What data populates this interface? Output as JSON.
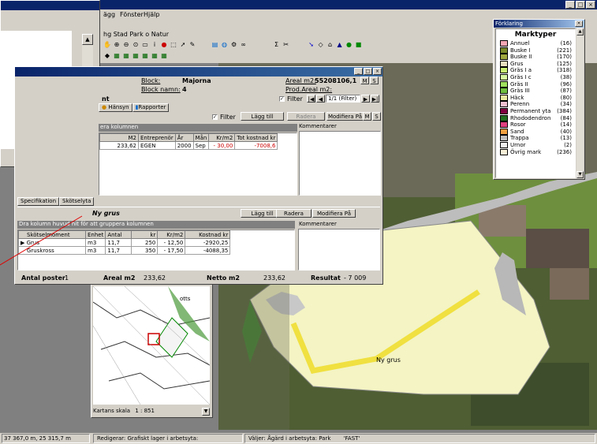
{
  "app": {
    "menu": [
      "ägg",
      "Fönster",
      "Hjälp"
    ],
    "toolbar_text": "hg Stad  Park o Natur",
    "window_controls": [
      "_",
      "□",
      "×"
    ]
  },
  "dialog": {
    "block_label": "Block:",
    "block_value": "Majorna",
    "block_name_label": "Block namn:",
    "block_name_value": "4",
    "areal_label": "Areal m2:",
    "areal_value": "55208106,1",
    "prod_areal_label": "Prod.Areal m2:",
    "filter_label": "Filter",
    "nav_text": "1/1 (Filter)",
    "tabs": [
      "Hänsyn",
      "Rapporter"
    ],
    "m_label": "M",
    "s_label": "S",
    "nt_label": "nt",
    "filter2_label": "Filter",
    "lagg_till": "Lägg till",
    "radera": "Radera",
    "modifiera": "Modifiera På",
    "group_hint": "era kolumnen",
    "kommentarer": "Kommentarer",
    "upper_headers": [
      "M2",
      "Entreprenör",
      "År",
      "Mån",
      "Kr/m2",
      "Tot kostnad kr"
    ],
    "upper_row": [
      "233,62",
      "EGEN",
      "2000",
      "Sep",
      "- 30,00",
      "-7008,6"
    ],
    "lower_tabs": [
      "Specifikation",
      "Skötselyta"
    ],
    "lower_title": "Ny grus",
    "lower_lagg_till": "Lägg till",
    "lower_radera": "Radera",
    "lower_modifiera": "Modifiera På",
    "lower_group_hint": "Dra kolumn huvud hit för att gruppera kolumnen",
    "lower_kommentarer": "Kommentarer",
    "lower_headers": [
      "Skötselmoment",
      "Enhet",
      "Antal",
      "kr",
      "Kr/m2",
      "Kostnad kr"
    ],
    "lower_rows": [
      [
        "Grus",
        "m3",
        "11,7",
        "250",
        "- 12,50",
        "-2920,25"
      ],
      [
        "Gruskross",
        "m3",
        "11,7",
        "350",
        "- 17,50",
        "-4088,35"
      ]
    ],
    "footer": {
      "antal_label": "Antal poster",
      "antal_value": "1",
      "areal_label": "Areal m2",
      "areal_value": "233,62",
      "netto_label": "Netto m2",
      "netto_value": "233,62",
      "resultat_label": "Resultat",
      "resultat_value": "- 7 009"
    }
  },
  "legend": {
    "window_title": "Förklaring",
    "heading": "Marktyper",
    "items": [
      {
        "name": "Annuel",
        "count": "(16)",
        "color": "#f4a6b4"
      },
      {
        "name": "Buske I",
        "count": "(221)",
        "color": "#7a8a2a"
      },
      {
        "name": "Buske II",
        "count": "(170)",
        "color": "#a0a840"
      },
      {
        "name": "Grus",
        "count": "(125)",
        "color": "#e8e0c0"
      },
      {
        "name": "Gräs I a",
        "count": "(318)",
        "color": "#c8f070"
      },
      {
        "name": "Gräs I c",
        "count": "(38)",
        "color": "#d8f8a0"
      },
      {
        "name": "Gräs II",
        "count": "(96)",
        "color": "#a0e060"
      },
      {
        "name": "Gräs III",
        "count": "(87)",
        "color": "#70c040"
      },
      {
        "name": "Häck",
        "count": "(80)",
        "color": "#e8e8a0"
      },
      {
        "name": "Perenn",
        "count": "(34)",
        "color": "#f0c0d0"
      },
      {
        "name": "Permanent yta",
        "count": "(384)",
        "color": "#800040"
      },
      {
        "name": "Rhododendron",
        "count": "(84)",
        "color": "#207020"
      },
      {
        "name": "Rosor",
        "count": "(14)",
        "color": "#e04080"
      },
      {
        "name": "Sand",
        "count": "(40)",
        "color": "#f0a040"
      },
      {
        "name": "Trappa",
        "count": "(13)",
        "color": "#c0c0c0"
      },
      {
        "name": "Urnor",
        "count": "(2)",
        "color": "#f0f0f0"
      },
      {
        "name": "Övrig mark",
        "count": "(236)",
        "color": "#f8f0d8"
      }
    ]
  },
  "map": {
    "path_label": "Ny grus",
    "overview_scale_label": "Kartans skala",
    "overview_scale_value": "1 : 851",
    "overview_place": "otts"
  },
  "statusbar": {
    "coords": "37 367,0 m, 25 315,7 m",
    "edit": "Redigerar: Grafiskt lager i arbetsyta:",
    "select": "Väljer: Ågärd i arbetsyta: Park",
    "fast": "'FAST'"
  },
  "colors": {
    "title_blue": "#0a246a",
    "selected_row": "#000080",
    "grus_fill": "#f4f4c4",
    "path_yellow": "#f0e040"
  }
}
